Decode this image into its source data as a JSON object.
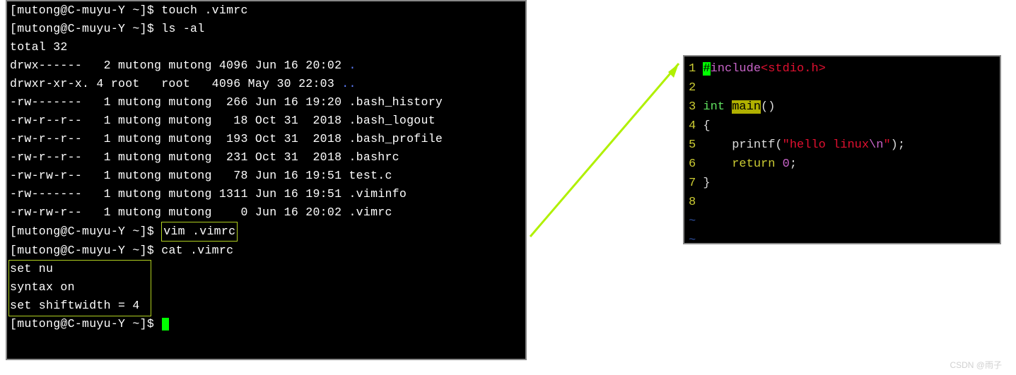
{
  "terminal": {
    "prompt": "[mutong@C-muyu-Y ~]$",
    "cmd_touch": " touch .vimrc",
    "cmd_ls": " ls -al",
    "total_line": "total 32",
    "files": [
      {
        "perms": "drwx------",
        "links": " 2",
        "owner": "mutong",
        "group": "mutong",
        "size": "4096",
        "month": "Jun",
        "day": "16",
        "time": "20:02",
        "name": ".",
        "blue": true
      },
      {
        "perms": "drwxr-xr-x.",
        "links": "4",
        "owner": "root  ",
        "group": "root  ",
        "size": "4096",
        "month": "May",
        "day": "30",
        "time": "22:03",
        "name": "..",
        "blue": true
      },
      {
        "perms": "-rw-------",
        "links": " 1",
        "owner": "mutong",
        "group": "mutong",
        "size": " 266",
        "month": "Jun",
        "day": "16",
        "time": "19:20",
        "name": ".bash_history",
        "blue": false
      },
      {
        "perms": "-rw-r--r--",
        "links": " 1",
        "owner": "mutong",
        "group": "mutong",
        "size": "  18",
        "month": "Oct",
        "day": "31",
        "time": " 2018",
        "name": ".bash_logout",
        "blue": false
      },
      {
        "perms": "-rw-r--r--",
        "links": " 1",
        "owner": "mutong",
        "group": "mutong",
        "size": " 193",
        "month": "Oct",
        "day": "31",
        "time": " 2018",
        "name": ".bash_profile",
        "blue": false
      },
      {
        "perms": "-rw-r--r--",
        "links": " 1",
        "owner": "mutong",
        "group": "mutong",
        "size": " 231",
        "month": "Oct",
        "day": "31",
        "time": " 2018",
        "name": ".bashrc",
        "blue": false
      },
      {
        "perms": "-rw-rw-r--",
        "links": " 1",
        "owner": "mutong",
        "group": "mutong",
        "size": "  78",
        "month": "Jun",
        "day": "16",
        "time": "19:51",
        "name": "test.c",
        "blue": false
      },
      {
        "perms": "-rw-------",
        "links": " 1",
        "owner": "mutong",
        "group": "mutong",
        "size": "1311",
        "month": "Jun",
        "day": "16",
        "time": "19:51",
        "name": ".viminfo",
        "blue": false
      },
      {
        "perms": "-rw-rw-r--",
        "links": " 1",
        "owner": "mutong",
        "group": "mutong",
        "size": "   0",
        "month": "Jun",
        "day": "16",
        "time": "20:02",
        "name": ".vimrc",
        "blue": false
      }
    ],
    "cmd_vim": "vim .vimrc",
    "cmd_cat": " cat .vimrc",
    "vimrc_lines": [
      "set nu",
      "syntax on",
      "set shiftwidth = 4"
    ],
    "final_prompt": "[mutong@C-muyu-Y ~]$ "
  },
  "vim": {
    "lines": [
      {
        "no": "1",
        "tokens": [
          {
            "t": "#",
            "cls": "vim-cursor-hl"
          },
          {
            "t": "include",
            "cls": "vim-preproc"
          },
          {
            "t": "<stdio.h>",
            "cls": "vim-include-str"
          }
        ]
      },
      {
        "no": "2",
        "tokens": []
      },
      {
        "no": "3",
        "tokens": [
          {
            "t": "int ",
            "cls": "vim-type"
          },
          {
            "t": "main",
            "cls": "vim-main-hl"
          },
          {
            "t": "()",
            "cls": "vim-paren"
          }
        ]
      },
      {
        "no": "4",
        "tokens": [
          {
            "t": "{",
            "cls": "vim-brace"
          }
        ]
      },
      {
        "no": "5",
        "tokens": [
          {
            "t": "    printf(",
            "cls": "vim-func"
          },
          {
            "t": "\"hello linux",
            "cls": "vim-string"
          },
          {
            "t": "\\n",
            "cls": "vim-escape"
          },
          {
            "t": "\"",
            "cls": "vim-string"
          },
          {
            "t": ");",
            "cls": "vim-func"
          }
        ]
      },
      {
        "no": "6",
        "tokens": [
          {
            "t": "    ",
            "cls": "vim-func"
          },
          {
            "t": "return",
            "cls": "vim-keyword"
          },
          {
            "t": " ",
            "cls": "vim-func"
          },
          {
            "t": "0",
            "cls": "vim-number"
          },
          {
            "t": ";",
            "cls": "vim-func"
          }
        ]
      },
      {
        "no": "7",
        "tokens": [
          {
            "t": "}",
            "cls": "vim-brace"
          }
        ]
      },
      {
        "no": "8",
        "tokens": []
      }
    ],
    "tildes": [
      "~",
      "~"
    ]
  },
  "watermark": "CSDN @雨子"
}
